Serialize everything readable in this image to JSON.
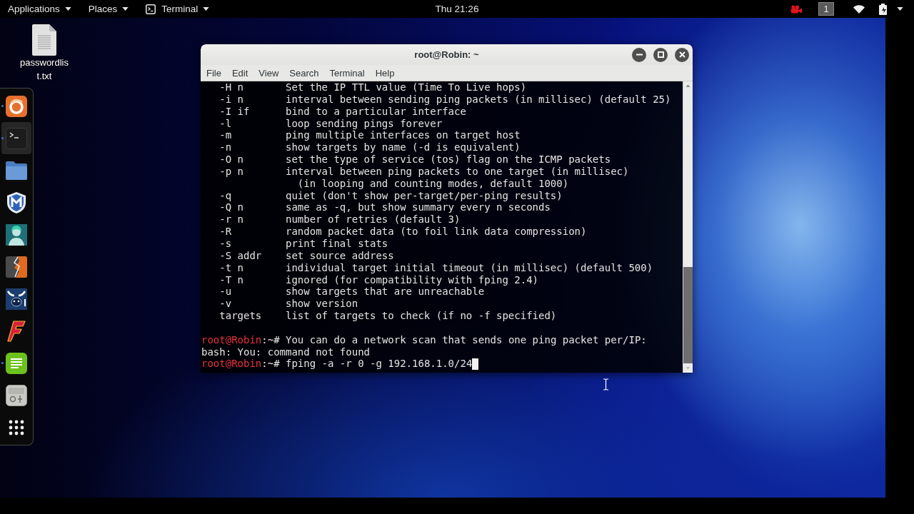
{
  "top_bar": {
    "menus": [
      {
        "kind": "text",
        "label": "Applications"
      },
      {
        "kind": "text",
        "label": "Places"
      },
      {
        "kind": "app",
        "label": "Terminal"
      }
    ],
    "clock": "Thu 21:26",
    "workspace": "1"
  },
  "desktop_icons": [
    {
      "label": "passwordlist.txt"
    }
  ],
  "dock": {
    "items": [
      {
        "kind": "swirl",
        "running": true,
        "selected": false
      },
      {
        "kind": "prompt",
        "running": true,
        "selected": true
      },
      {
        "kind": "folder",
        "running": false,
        "selected": false
      },
      {
        "kind": "shield",
        "running": false,
        "selected": false
      },
      {
        "kind": "avatar",
        "running": false,
        "selected": false
      },
      {
        "kind": "split",
        "running": false,
        "selected": false
      },
      {
        "kind": "horns",
        "running": false,
        "selected": false
      },
      {
        "kind": "slant",
        "running": false,
        "selected": false
      },
      {
        "kind": "notes",
        "running": true,
        "selected": false
      },
      {
        "kind": "panel",
        "running": false,
        "selected": false
      },
      {
        "kind": "grid",
        "running": false,
        "selected": false
      }
    ]
  },
  "terminal": {
    "title": "root@Robin: ~",
    "menu": [
      "File",
      "Edit",
      "View",
      "Search",
      "Terminal",
      "Help"
    ],
    "lines": [
      {
        "kind": "option",
        "option": "-H n",
        "text": "Set the IP TTL value (Time To Live hops)"
      },
      {
        "kind": "option",
        "option": "-i n",
        "text": "interval between sending ping packets (in millisec) (default 25)"
      },
      {
        "kind": "option",
        "option": "-I if",
        "text": "bind to a particular interface"
      },
      {
        "kind": "option",
        "option": "-l",
        "text": "loop sending pings forever"
      },
      {
        "kind": "option",
        "option": "-m",
        "text": "ping multiple interfaces on target host"
      },
      {
        "kind": "option",
        "option": "-n",
        "text": "show targets by name (-d is equivalent)"
      },
      {
        "kind": "option",
        "option": "-O n",
        "text": "set the type of service (tos) flag on the ICMP packets"
      },
      {
        "kind": "option",
        "option": "-p n",
        "text": "interval between ping packets to one target (in millisec)"
      },
      {
        "kind": "continuation",
        "text": "(in looping and counting modes, default 1000)"
      },
      {
        "kind": "option",
        "option": "-q",
        "text": "quiet (don't show per-target/per-ping results)"
      },
      {
        "kind": "option",
        "option": "-Q n",
        "text": "same as -q, but show summary every n seconds"
      },
      {
        "kind": "option",
        "option": "-r n",
        "text": "number of retries (default 3)"
      },
      {
        "kind": "option",
        "option": "-R",
        "text": "random packet data (to foil link data compression)"
      },
      {
        "kind": "option",
        "option": "-s",
        "text": "print final stats"
      },
      {
        "kind": "option",
        "option": "-S addr",
        "text": "set source address"
      },
      {
        "kind": "option",
        "option": "-t n",
        "text": "individual target initial timeout (in millisec) (default 500)"
      },
      {
        "kind": "option",
        "option": "-T n",
        "text": "ignored (for compatibility with fping 2.4)"
      },
      {
        "kind": "option",
        "option": "-u",
        "text": "show targets that are unreachable"
      },
      {
        "kind": "option",
        "option": "-v",
        "text": "show version"
      },
      {
        "kind": "option",
        "option": "targets",
        "text": "list of targets to check (if no -f specified)"
      },
      {
        "kind": "blank"
      },
      {
        "kind": "prompt",
        "user": "root@Robin",
        "path": ":~#",
        "text": "You can do a network scan that sends one ping packet per/IP:",
        "cursor": false
      },
      {
        "kind": "output",
        "text": "bash: You: command not found"
      },
      {
        "kind": "prompt",
        "user": "root@Robin",
        "path": ":~#",
        "text": "fping -a -r 0 -g 192.168.1.0/24",
        "cursor": true
      }
    ]
  }
}
